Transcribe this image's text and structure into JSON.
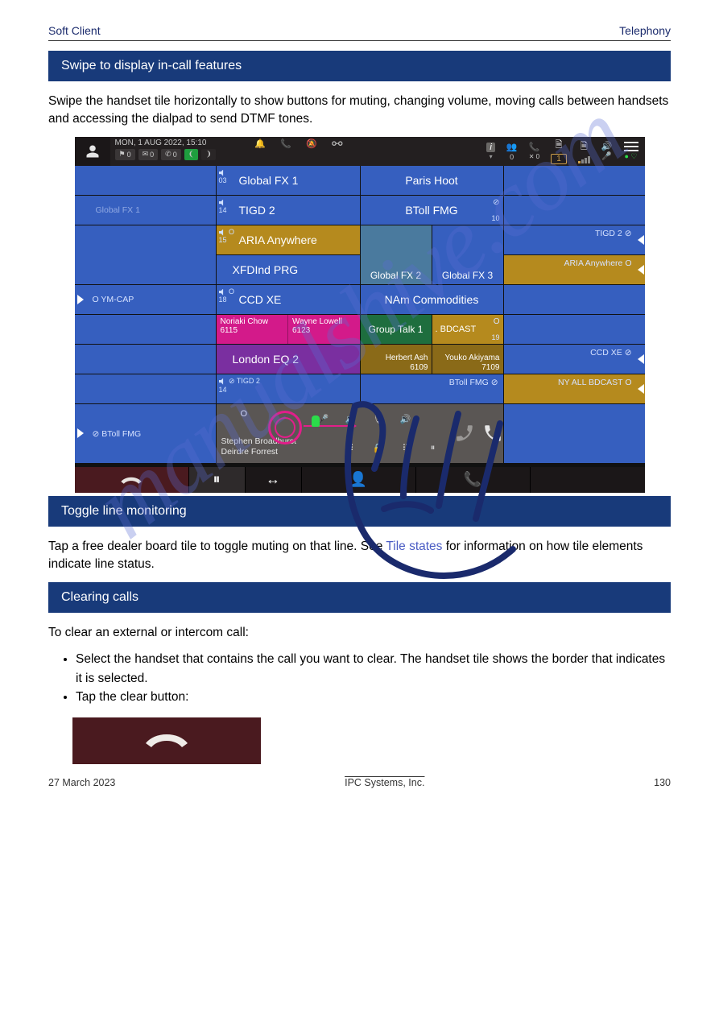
{
  "header": {
    "left": "Soft Client",
    "right": "Telephony"
  },
  "section1": {
    "title": "Swipe to display in-call features",
    "intro": "Swipe the handset tile horizontally to show buttons for muting, changing volume, moving calls between handsets and accessing the dialpad to send DTMF tones."
  },
  "screenshot": {
    "datetime": "MON, 1 AUG 2022, 15:10",
    "pills": [
      "0",
      "0",
      "0"
    ],
    "top_icons": {
      "contacts_count": "0",
      "calls_count": "0",
      "doc_badge": "1"
    },
    "tiles": {
      "col2": [
        {
          "n": "03",
          "label": "Global FX 1"
        },
        {
          "n": "14",
          "label": "TIGD 2"
        },
        {
          "n": "15",
          "label": "ARIA Anywhere",
          "color": "mustard",
          "ring": "O"
        },
        {
          "label": "XFDInd PRG"
        },
        {
          "n": "18",
          "label": "CCD XE",
          "ring": "O"
        },
        {
          "split": true,
          "a": {
            "name": "Noriaki Chow",
            "num": "6115"
          },
          "b": {
            "name": "Wayne Lowell",
            "num": "6123"
          },
          "color": "magenta"
        },
        {
          "label": "London EQ 2",
          "color": "purple"
        },
        {
          "n": "14",
          "label": "TIGD 2",
          "small": true,
          "badge": "Ø"
        }
      ],
      "col3": [
        {
          "label": "Paris Hoot",
          "span": 2
        },
        {
          "label": "BToll FMG",
          "span": 2,
          "badge": "Ø",
          "rt": "10"
        },
        {
          "a": "Global FX 2",
          "b": "Global FX 3",
          "color_a": "teal"
        },
        {
          "label": "NAm Commodities",
          "span": 2
        },
        {
          "a": "Group Talk 1",
          "b": ". BDCAST",
          "color_a": "green",
          "color_b": "mustard",
          "rb": "19",
          "dot": "O"
        },
        {
          "a": {
            "name": "Herbert Ash",
            "num": "6109"
          },
          "b": {
            "name": "Youko Akiyama",
            "num": "7109"
          },
          "color": "dkmust"
        },
        {
          "label": "BToll FMG",
          "span": 2,
          "badge": "Ø",
          "small": true
        }
      ],
      "col1": [
        "",
        {
          "label": "Global FX 1",
          "faint": true
        },
        "",
        {
          "label": "YM-CAP",
          "ring": "O",
          "tri": "l",
          "small": true
        },
        "",
        "",
        "",
        {
          "label": "BToll FMG",
          "ring": "Ø",
          "tri": "l",
          "small": true
        }
      ],
      "col5": [
        "",
        "",
        {
          "label": "TIGD 2",
          "badge": "Ø",
          "tri": "r",
          "small": true
        },
        {
          "label": "ARIA Anywhere",
          "ring": "O",
          "tri": "r",
          "small": true,
          "color": "mustard"
        },
        "",
        "",
        {
          "label": "CCD XE",
          "badge": "Ø",
          "tri": "r",
          "small": true
        },
        {
          "label": "NY ALL BDCAST",
          "ring": "O",
          "tri": "r",
          "small": true,
          "color": "mustard"
        }
      ]
    },
    "handset": {
      "names": [
        "Stephen Broadhurst",
        "Deirdre Forrest"
      ],
      "ring": "O"
    }
  },
  "section2": {
    "title": "Toggle line monitoring",
    "body_parts": [
      "Tap a free dealer board tile to toggle muting on that line. See ",
      "Tile states",
      "  for information on how tile elements indicate line status."
    ]
  },
  "section3": {
    "title": "Clearing calls",
    "intro": "To clear an external or intercom call:",
    "bullets": [
      "Select the handset that contains the call you want to clear. The handset tile shows the border that indicates it is selected.",
      "Tap the clear button:"
    ]
  },
  "footer": {
    "left": "27 March 2023",
    "mid": "IPC Systems, Inc.",
    "right": "130"
  }
}
